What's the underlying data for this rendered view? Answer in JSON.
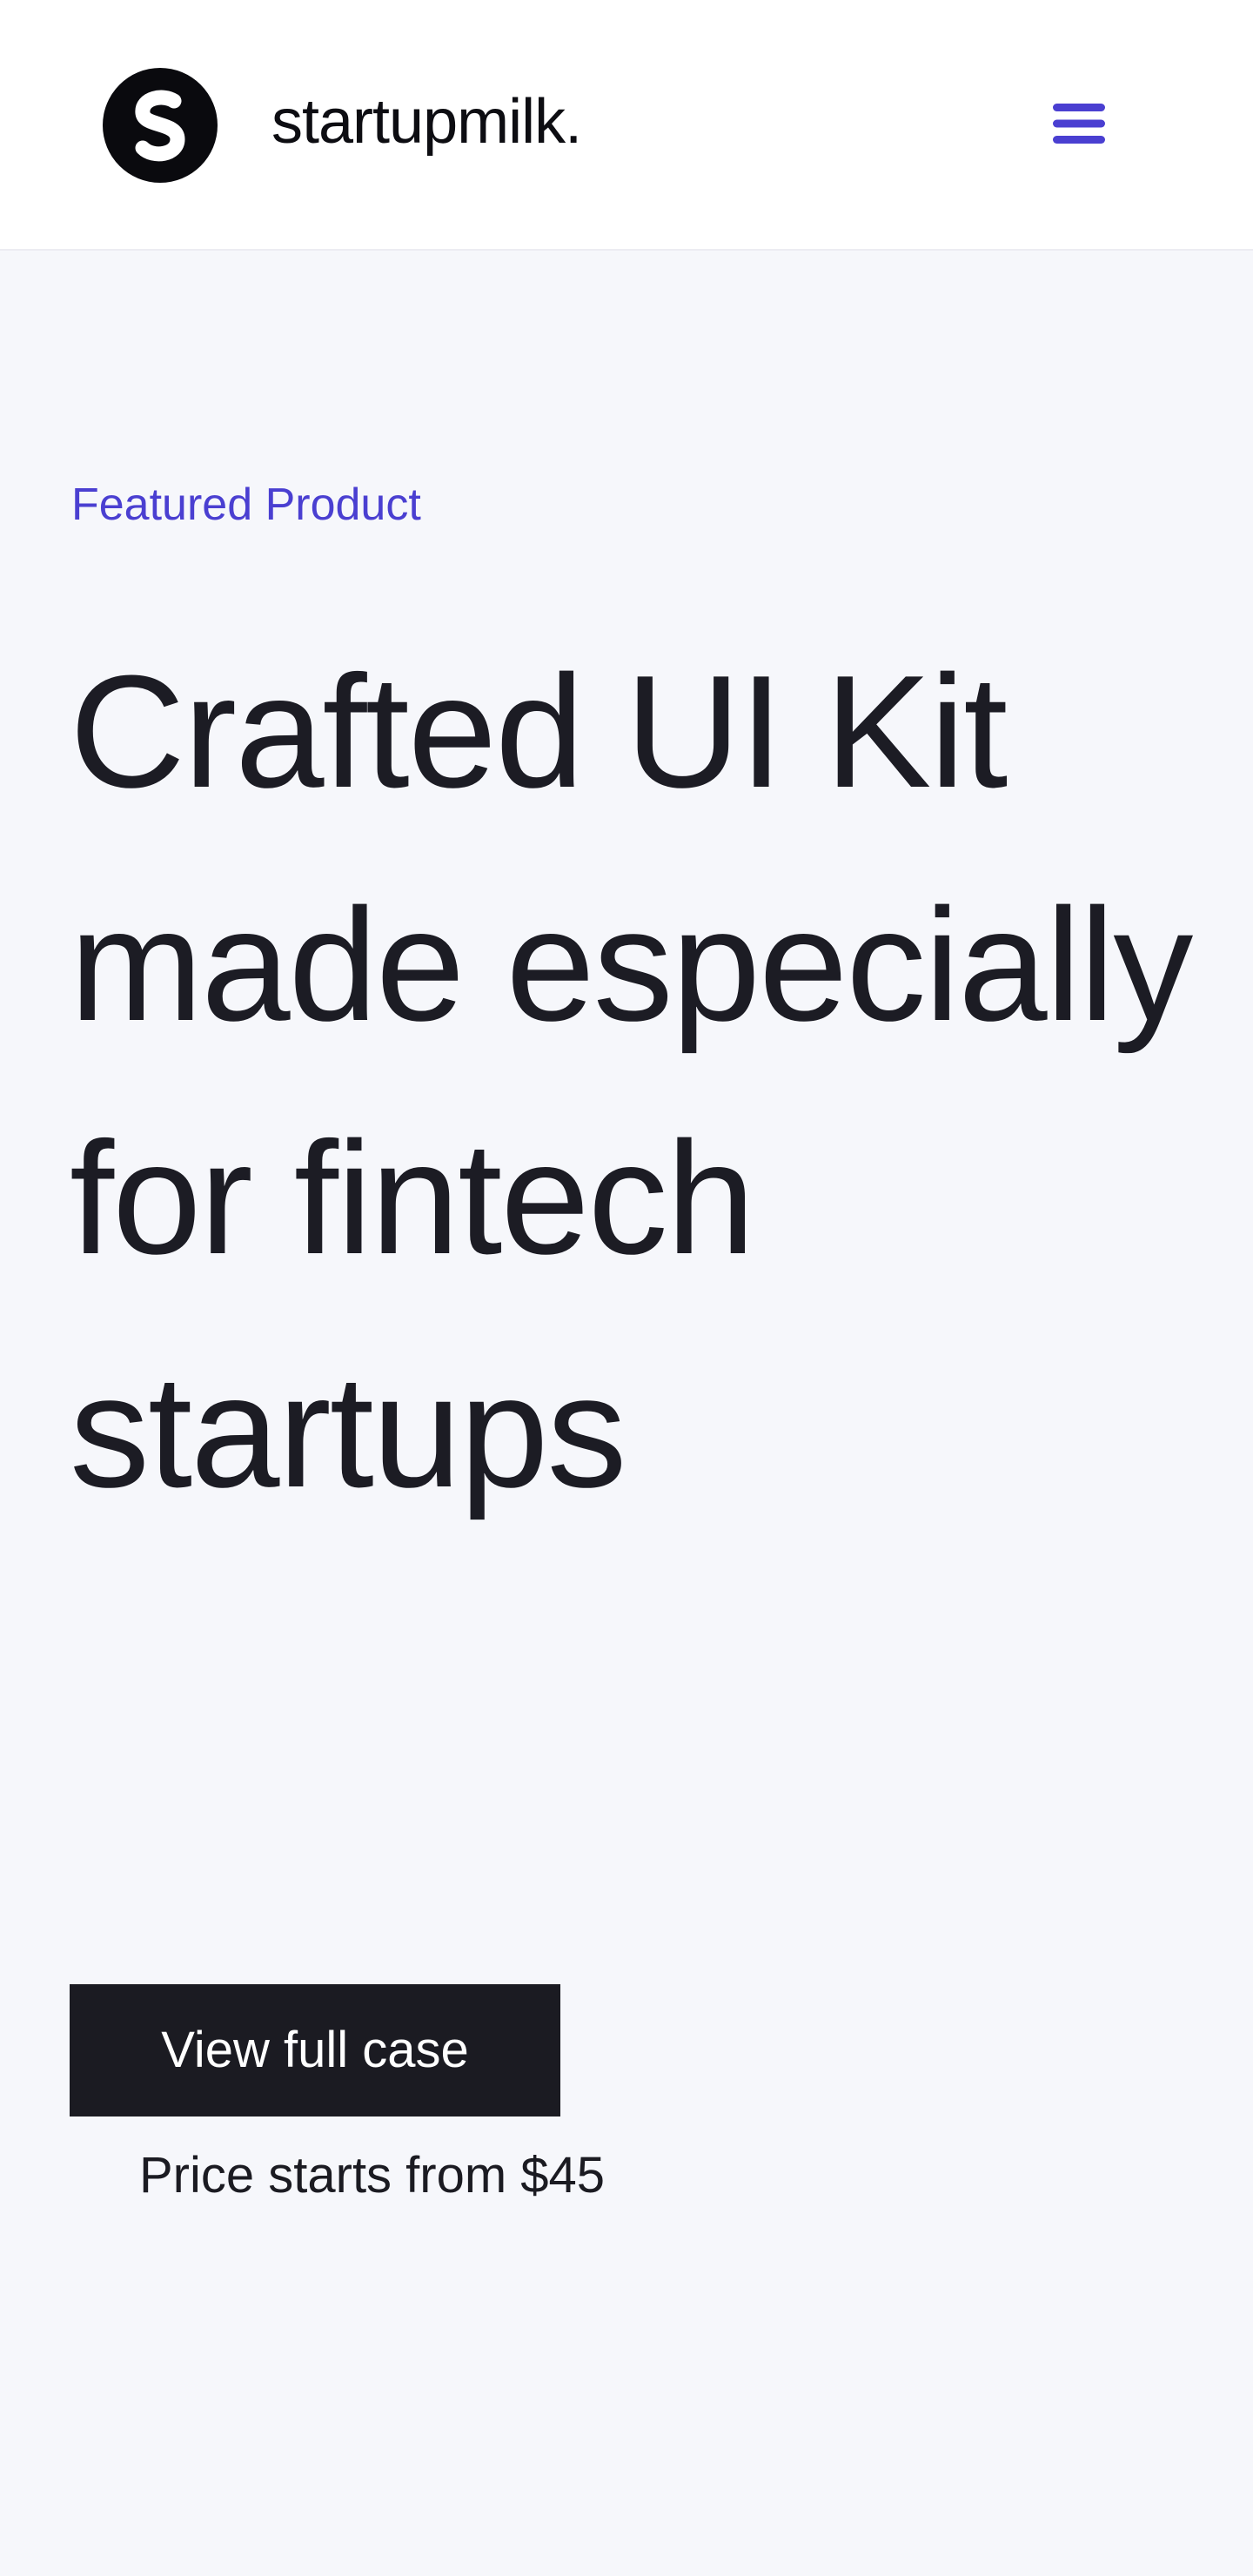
{
  "header": {
    "logo_icon": "startupmilk-s-logo-icon",
    "brand_name": "startupmilk.",
    "menu_icon": "hamburger-menu-icon",
    "accent_color": "#4a3fd1"
  },
  "hero": {
    "eyebrow": "Featured Product",
    "headline": "Crafted UI Kit made especially for fintech startups",
    "cta_label": "View full case",
    "price_note": "Price starts from $45"
  },
  "colors": {
    "background": "#f6f7fb",
    "header_background": "#ffffff",
    "text": "#1b1b22",
    "accent": "#4a3fd1",
    "button_background": "#1b1b22",
    "button_text": "#ffffff"
  }
}
